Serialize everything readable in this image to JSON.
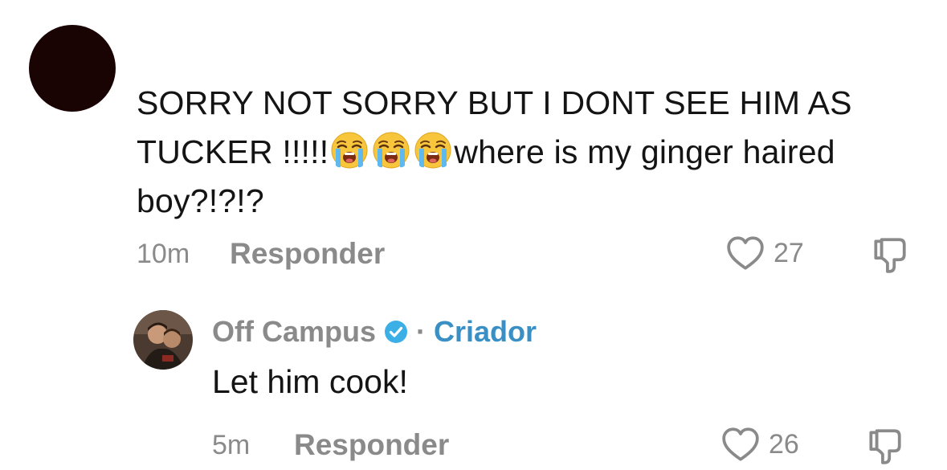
{
  "comment": {
    "text_part1": "SORRY NOT SORRY BUT I DONT SEE HIM AS TUCKER !!!!!",
    "emoji": "loudly-crying-face",
    "text_part2": "where is my ginger haired boy?!?!?",
    "time": "10m",
    "reply_label": "Responder",
    "likes": "27"
  },
  "reply": {
    "author": "Off Campus",
    "separator": "·",
    "role": "Criador",
    "text": "Let him cook!",
    "time": "5m",
    "reply_label": "Responder",
    "likes": "26"
  },
  "colors": {
    "creator_accent": "#3a8fc4",
    "verified_badge": "#3cb0e6",
    "meta_gray": "#8a8a8a",
    "avatar_dark": "#1a0303"
  }
}
